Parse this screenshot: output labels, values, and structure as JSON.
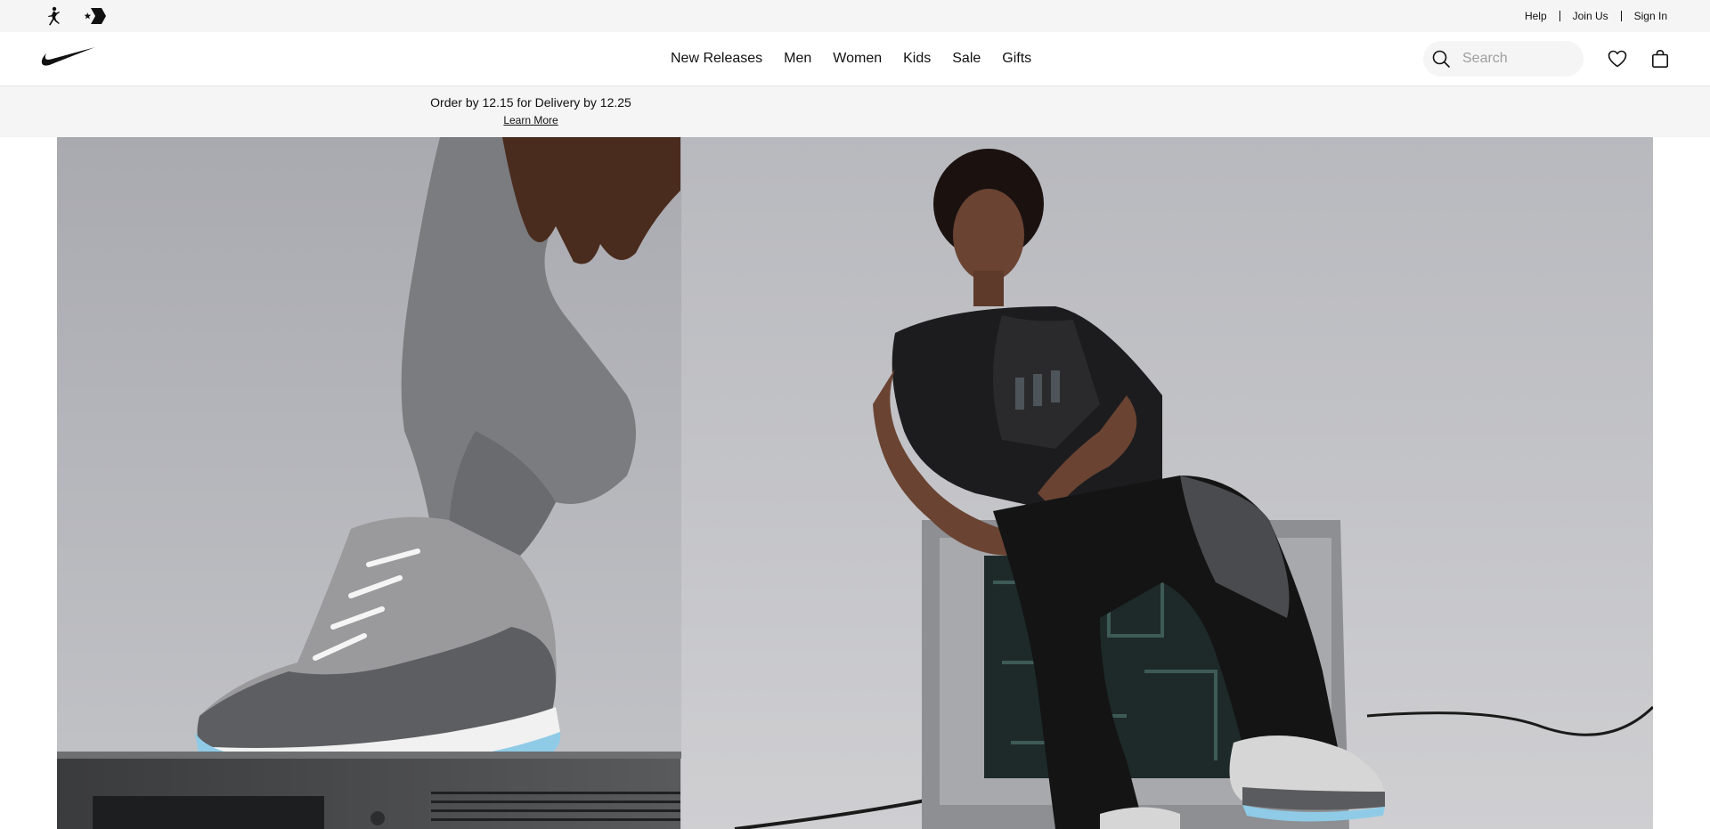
{
  "utility_bar": {
    "brand_icons": [
      "jordan-icon",
      "converse-icon"
    ],
    "links": [
      {
        "label": "Help"
      },
      {
        "label": "Join Us"
      },
      {
        "label": "Sign In"
      }
    ]
  },
  "nav": {
    "logo": "nike-swoosh-logo",
    "links": [
      {
        "label": "New Releases"
      },
      {
        "label": "Men"
      },
      {
        "label": "Women"
      },
      {
        "label": "Kids"
      },
      {
        "label": "Sale"
      },
      {
        "label": "Gifts"
      }
    ],
    "search": {
      "placeholder": "Search",
      "value": ""
    },
    "icons": [
      "heart-icon",
      "bag-icon"
    ]
  },
  "promo": {
    "text": "Order by 12.15 for Delivery by 12.25",
    "link": "Learn More"
  },
  "hero": {
    "images": [
      "sneaker-on-tv-image",
      "model-sitting-on-tv-image"
    ]
  },
  "colors": {
    "utility_bg": "#f5f5f5",
    "text": "#111111",
    "hero_left_bg": "#b3b4b9",
    "hero_right_bg": "#bfc0c4",
    "sole_blue": "#8fcbe6"
  }
}
